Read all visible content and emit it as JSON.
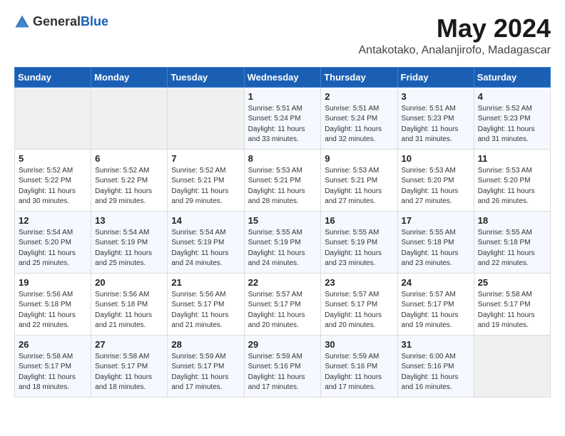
{
  "logo": {
    "general": "General",
    "blue": "Blue"
  },
  "header": {
    "title": "May 2024",
    "subtitle": "Antakotako, Analanjirofo, Madagascar"
  },
  "days_of_week": [
    "Sunday",
    "Monday",
    "Tuesday",
    "Wednesday",
    "Thursday",
    "Friday",
    "Saturday"
  ],
  "weeks": [
    [
      {
        "day": "",
        "info": ""
      },
      {
        "day": "",
        "info": ""
      },
      {
        "day": "",
        "info": ""
      },
      {
        "day": "1",
        "info": "Sunrise: 5:51 AM\nSunset: 5:24 PM\nDaylight: 11 hours and 33 minutes."
      },
      {
        "day": "2",
        "info": "Sunrise: 5:51 AM\nSunset: 5:24 PM\nDaylight: 11 hours and 32 minutes."
      },
      {
        "day": "3",
        "info": "Sunrise: 5:51 AM\nSunset: 5:23 PM\nDaylight: 11 hours and 31 minutes."
      },
      {
        "day": "4",
        "info": "Sunrise: 5:52 AM\nSunset: 5:23 PM\nDaylight: 11 hours and 31 minutes."
      }
    ],
    [
      {
        "day": "5",
        "info": "Sunrise: 5:52 AM\nSunset: 5:22 PM\nDaylight: 11 hours and 30 minutes."
      },
      {
        "day": "6",
        "info": "Sunrise: 5:52 AM\nSunset: 5:22 PM\nDaylight: 11 hours and 29 minutes."
      },
      {
        "day": "7",
        "info": "Sunrise: 5:52 AM\nSunset: 5:21 PM\nDaylight: 11 hours and 29 minutes."
      },
      {
        "day": "8",
        "info": "Sunrise: 5:53 AM\nSunset: 5:21 PM\nDaylight: 11 hours and 28 minutes."
      },
      {
        "day": "9",
        "info": "Sunrise: 5:53 AM\nSunset: 5:21 PM\nDaylight: 11 hours and 27 minutes."
      },
      {
        "day": "10",
        "info": "Sunrise: 5:53 AM\nSunset: 5:20 PM\nDaylight: 11 hours and 27 minutes."
      },
      {
        "day": "11",
        "info": "Sunrise: 5:53 AM\nSunset: 5:20 PM\nDaylight: 11 hours and 26 minutes."
      }
    ],
    [
      {
        "day": "12",
        "info": "Sunrise: 5:54 AM\nSunset: 5:20 PM\nDaylight: 11 hours and 25 minutes."
      },
      {
        "day": "13",
        "info": "Sunrise: 5:54 AM\nSunset: 5:19 PM\nDaylight: 11 hours and 25 minutes."
      },
      {
        "day": "14",
        "info": "Sunrise: 5:54 AM\nSunset: 5:19 PM\nDaylight: 11 hours and 24 minutes."
      },
      {
        "day": "15",
        "info": "Sunrise: 5:55 AM\nSunset: 5:19 PM\nDaylight: 11 hours and 24 minutes."
      },
      {
        "day": "16",
        "info": "Sunrise: 5:55 AM\nSunset: 5:19 PM\nDaylight: 11 hours and 23 minutes."
      },
      {
        "day": "17",
        "info": "Sunrise: 5:55 AM\nSunset: 5:18 PM\nDaylight: 11 hours and 23 minutes."
      },
      {
        "day": "18",
        "info": "Sunrise: 5:55 AM\nSunset: 5:18 PM\nDaylight: 11 hours and 22 minutes."
      }
    ],
    [
      {
        "day": "19",
        "info": "Sunrise: 5:56 AM\nSunset: 5:18 PM\nDaylight: 11 hours and 22 minutes."
      },
      {
        "day": "20",
        "info": "Sunrise: 5:56 AM\nSunset: 5:18 PM\nDaylight: 11 hours and 21 minutes."
      },
      {
        "day": "21",
        "info": "Sunrise: 5:56 AM\nSunset: 5:17 PM\nDaylight: 11 hours and 21 minutes."
      },
      {
        "day": "22",
        "info": "Sunrise: 5:57 AM\nSunset: 5:17 PM\nDaylight: 11 hours and 20 minutes."
      },
      {
        "day": "23",
        "info": "Sunrise: 5:57 AM\nSunset: 5:17 PM\nDaylight: 11 hours and 20 minutes."
      },
      {
        "day": "24",
        "info": "Sunrise: 5:57 AM\nSunset: 5:17 PM\nDaylight: 11 hours and 19 minutes."
      },
      {
        "day": "25",
        "info": "Sunrise: 5:58 AM\nSunset: 5:17 PM\nDaylight: 11 hours and 19 minutes."
      }
    ],
    [
      {
        "day": "26",
        "info": "Sunrise: 5:58 AM\nSunset: 5:17 PM\nDaylight: 11 hours and 18 minutes."
      },
      {
        "day": "27",
        "info": "Sunrise: 5:58 AM\nSunset: 5:17 PM\nDaylight: 11 hours and 18 minutes."
      },
      {
        "day": "28",
        "info": "Sunrise: 5:59 AM\nSunset: 5:17 PM\nDaylight: 11 hours and 17 minutes."
      },
      {
        "day": "29",
        "info": "Sunrise: 5:59 AM\nSunset: 5:16 PM\nDaylight: 11 hours and 17 minutes."
      },
      {
        "day": "30",
        "info": "Sunrise: 5:59 AM\nSunset: 5:16 PM\nDaylight: 11 hours and 17 minutes."
      },
      {
        "day": "31",
        "info": "Sunrise: 6:00 AM\nSunset: 5:16 PM\nDaylight: 11 hours and 16 minutes."
      },
      {
        "day": "",
        "info": ""
      }
    ]
  ]
}
